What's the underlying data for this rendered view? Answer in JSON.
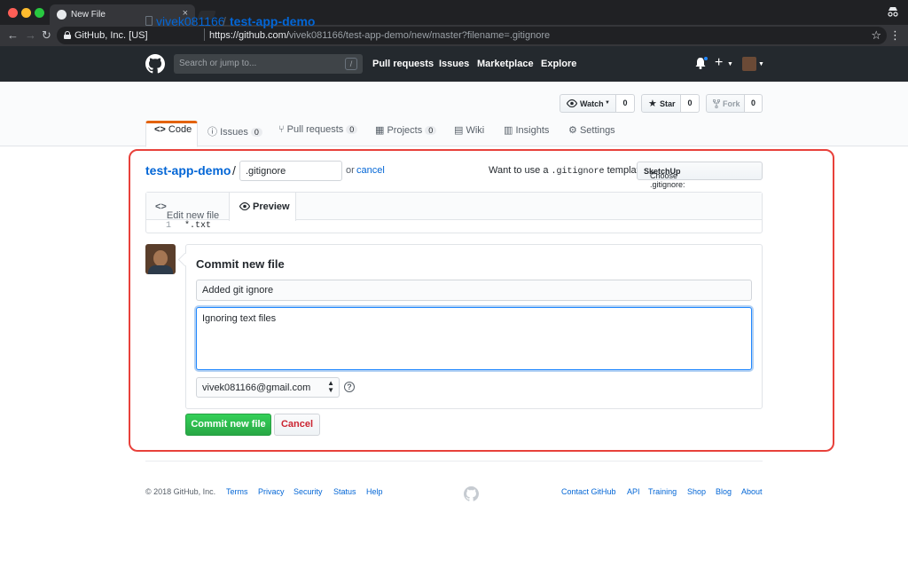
{
  "browser": {
    "tab_title": "New File",
    "tab_close": "×",
    "org": "GitHub, Inc. [US]",
    "url_host": "https://github.com/",
    "url_path": "vivek081166/test-app-demo/new/master?filename=.gitignore",
    "back": "←",
    "forward": "→",
    "reload": "↻",
    "star": "☆",
    "menu": "⋮",
    "incognito_icon": "incognito-icon"
  },
  "header": {
    "search_placeholder": "Search or jump to...",
    "search_key": "/",
    "nav": [
      "Pull requests",
      "Issues",
      "Marketplace",
      "Explore"
    ],
    "plus": "+"
  },
  "repo": {
    "owner": "vivek081166",
    "slash": "/",
    "name": "test-app-demo",
    "watch_label": "Watch",
    "watch_count": "0",
    "star_label": "Star",
    "star_count": "0",
    "fork_label": "Fork",
    "fork_count": "0",
    "tabs": [
      {
        "label": "Code"
      },
      {
        "label": "Issues",
        "count": "0"
      },
      {
        "label": "Pull requests",
        "count": "0"
      },
      {
        "label": "Projects",
        "count": "0"
      },
      {
        "label": "Wiki"
      },
      {
        "label": "Insights"
      },
      {
        "label": "Settings"
      }
    ]
  },
  "editor": {
    "breadcrumb_repo": "test-app-demo",
    "breadcrumb_slash": "/",
    "filename": ".gitignore",
    "or": "or",
    "cancel_link": "cancel",
    "template_question_prefix": "Want to use a",
    "template_question_code": ".gitignore",
    "template_question_suffix": "template?",
    "template_select_prefix": "Choose .gitignore:",
    "template_select_value": "SketchUp",
    "tab_edit": "Edit new file",
    "tab_preview": "Preview",
    "line_number": "1",
    "line_content": "*.txt"
  },
  "commit": {
    "title": "Commit new file",
    "summary": "Added git ignore",
    "description": "Ignoring text files",
    "email": "vivek081166@gmail.com",
    "help": "?",
    "commit_button": "Commit new file",
    "cancel_button": "Cancel"
  },
  "footer": {
    "copyright": "© 2018 GitHub, Inc.",
    "left_links": [
      "Terms",
      "Privacy",
      "Security",
      "Status",
      "Help"
    ],
    "right_links": [
      "Contact GitHub",
      "API",
      "Training",
      "Shop",
      "Blog",
      "About"
    ]
  },
  "colors": {
    "highlight": "#e8413b",
    "link": "#0366d6",
    "primary_button": "#28a745",
    "header_bg": "#24292e"
  }
}
